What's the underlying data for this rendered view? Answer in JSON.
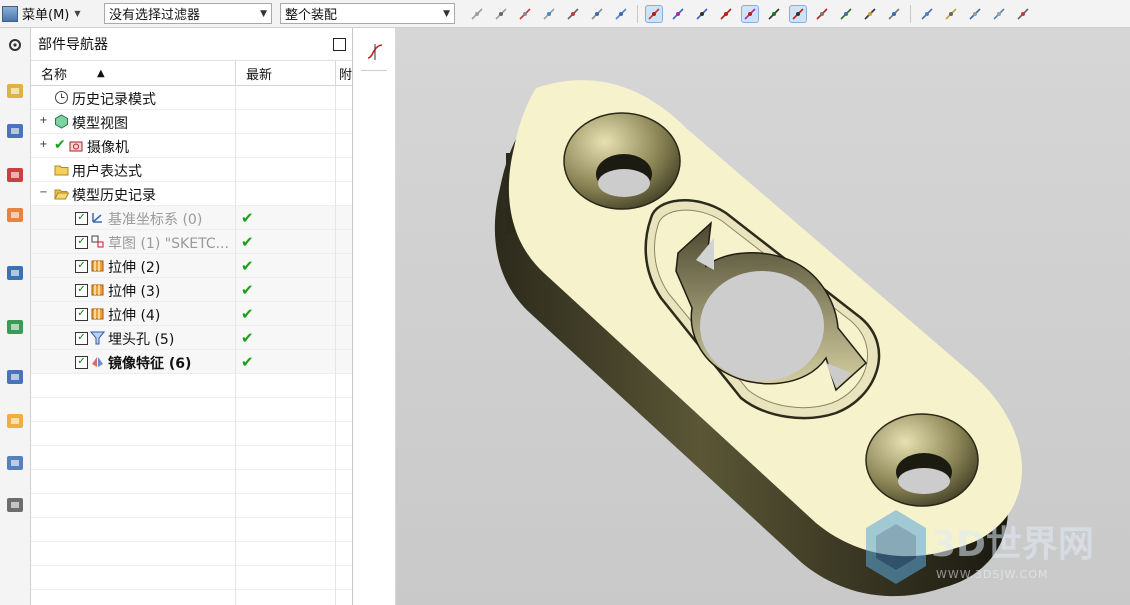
{
  "toolbar": {
    "menu_label": "菜单(M)",
    "filter_value": "没有选择过滤器",
    "scope_value": "整个装配",
    "icons": [
      "select-icon",
      "snap-icon",
      "point-icon",
      "move-icon",
      "box-select-icon",
      "shaded-icon",
      "solid-icon",
      "endpoint-icon",
      "midpoint-icon",
      "line-icon",
      "curve-icon",
      "control-point-icon",
      "intersection-icon",
      "center-icon",
      "quadrant-icon",
      "existing-point-icon",
      "point-on-curve-icon",
      "grid-icon",
      "view-fit-icon",
      "view-icon",
      "rotate-icon",
      "layout-icon",
      "render-icon"
    ]
  },
  "rail": {
    "icons": [
      "gear-icon",
      "assembly-navigator-icon",
      "constraint-navigator-icon",
      "part-navigator-icon",
      "reuse-library-icon",
      "web-browser-icon",
      "history-icon",
      "system-materials-icon",
      "process-studio-icon",
      "manikin-icon",
      "roles-icon"
    ]
  },
  "navigator": {
    "title": "部件导航器",
    "columns": {
      "name": "名称",
      "latest": "最新",
      "extra": "附"
    },
    "rows": [
      {
        "label": "历史记录模式",
        "icon": "clock-icon",
        "level": 0,
        "expander": "",
        "checked": false,
        "latest": ""
      },
      {
        "label": "模型视图",
        "icon": "model-view-icon",
        "level": 0,
        "expander": "+",
        "checked": false,
        "latest": ""
      },
      {
        "label": "摄像机",
        "icon": "camera-icon",
        "level": 0,
        "expander": "+",
        "checked": false,
        "latest": ""
      },
      {
        "label": "用户表达式",
        "icon": "folder-icon",
        "level": 0,
        "expander": "",
        "checked": false,
        "latest": ""
      },
      {
        "label": "模型历史记录",
        "icon": "folder-open-icon",
        "level": 0,
        "expander": "−",
        "checked": false,
        "latest": ""
      },
      {
        "label": "基准坐标系 (0)",
        "icon": "datum-csys-icon",
        "level": 1,
        "expander": "",
        "checked": true,
        "latest": "✔",
        "style": "dim"
      },
      {
        "label": "草图 (1) \"SKETC...",
        "icon": "sketch-icon",
        "level": 1,
        "expander": "",
        "checked": true,
        "latest": "✔",
        "style": "dim"
      },
      {
        "label": "拉伸 (2)",
        "icon": "extrude-icon",
        "level": 1,
        "expander": "",
        "checked": true,
        "latest": "✔",
        "style": ""
      },
      {
        "label": "拉伸 (3)",
        "icon": "extrude-icon",
        "level": 1,
        "expander": "",
        "checked": true,
        "latest": "✔",
        "style": ""
      },
      {
        "label": "拉伸 (4)",
        "icon": "extrude-icon",
        "level": 1,
        "expander": "",
        "checked": true,
        "latest": "✔",
        "style": ""
      },
      {
        "label": "埋头孔 (5)",
        "icon": "countersink-hole-icon",
        "level": 1,
        "expander": "",
        "checked": true,
        "latest": "✔",
        "style": ""
      },
      {
        "label": "镜像特征 (6)",
        "icon": "mirror-feature-icon",
        "level": 1,
        "expander": "",
        "checked": true,
        "latest": "✔",
        "style": "bold"
      }
    ]
  },
  "viewport": {
    "strip_icon": "curve-graph-icon",
    "model_color": "#f6f2cc",
    "watermark_text": "3D世界网",
    "watermark_url": "WWW.3DSJW.COM"
  }
}
